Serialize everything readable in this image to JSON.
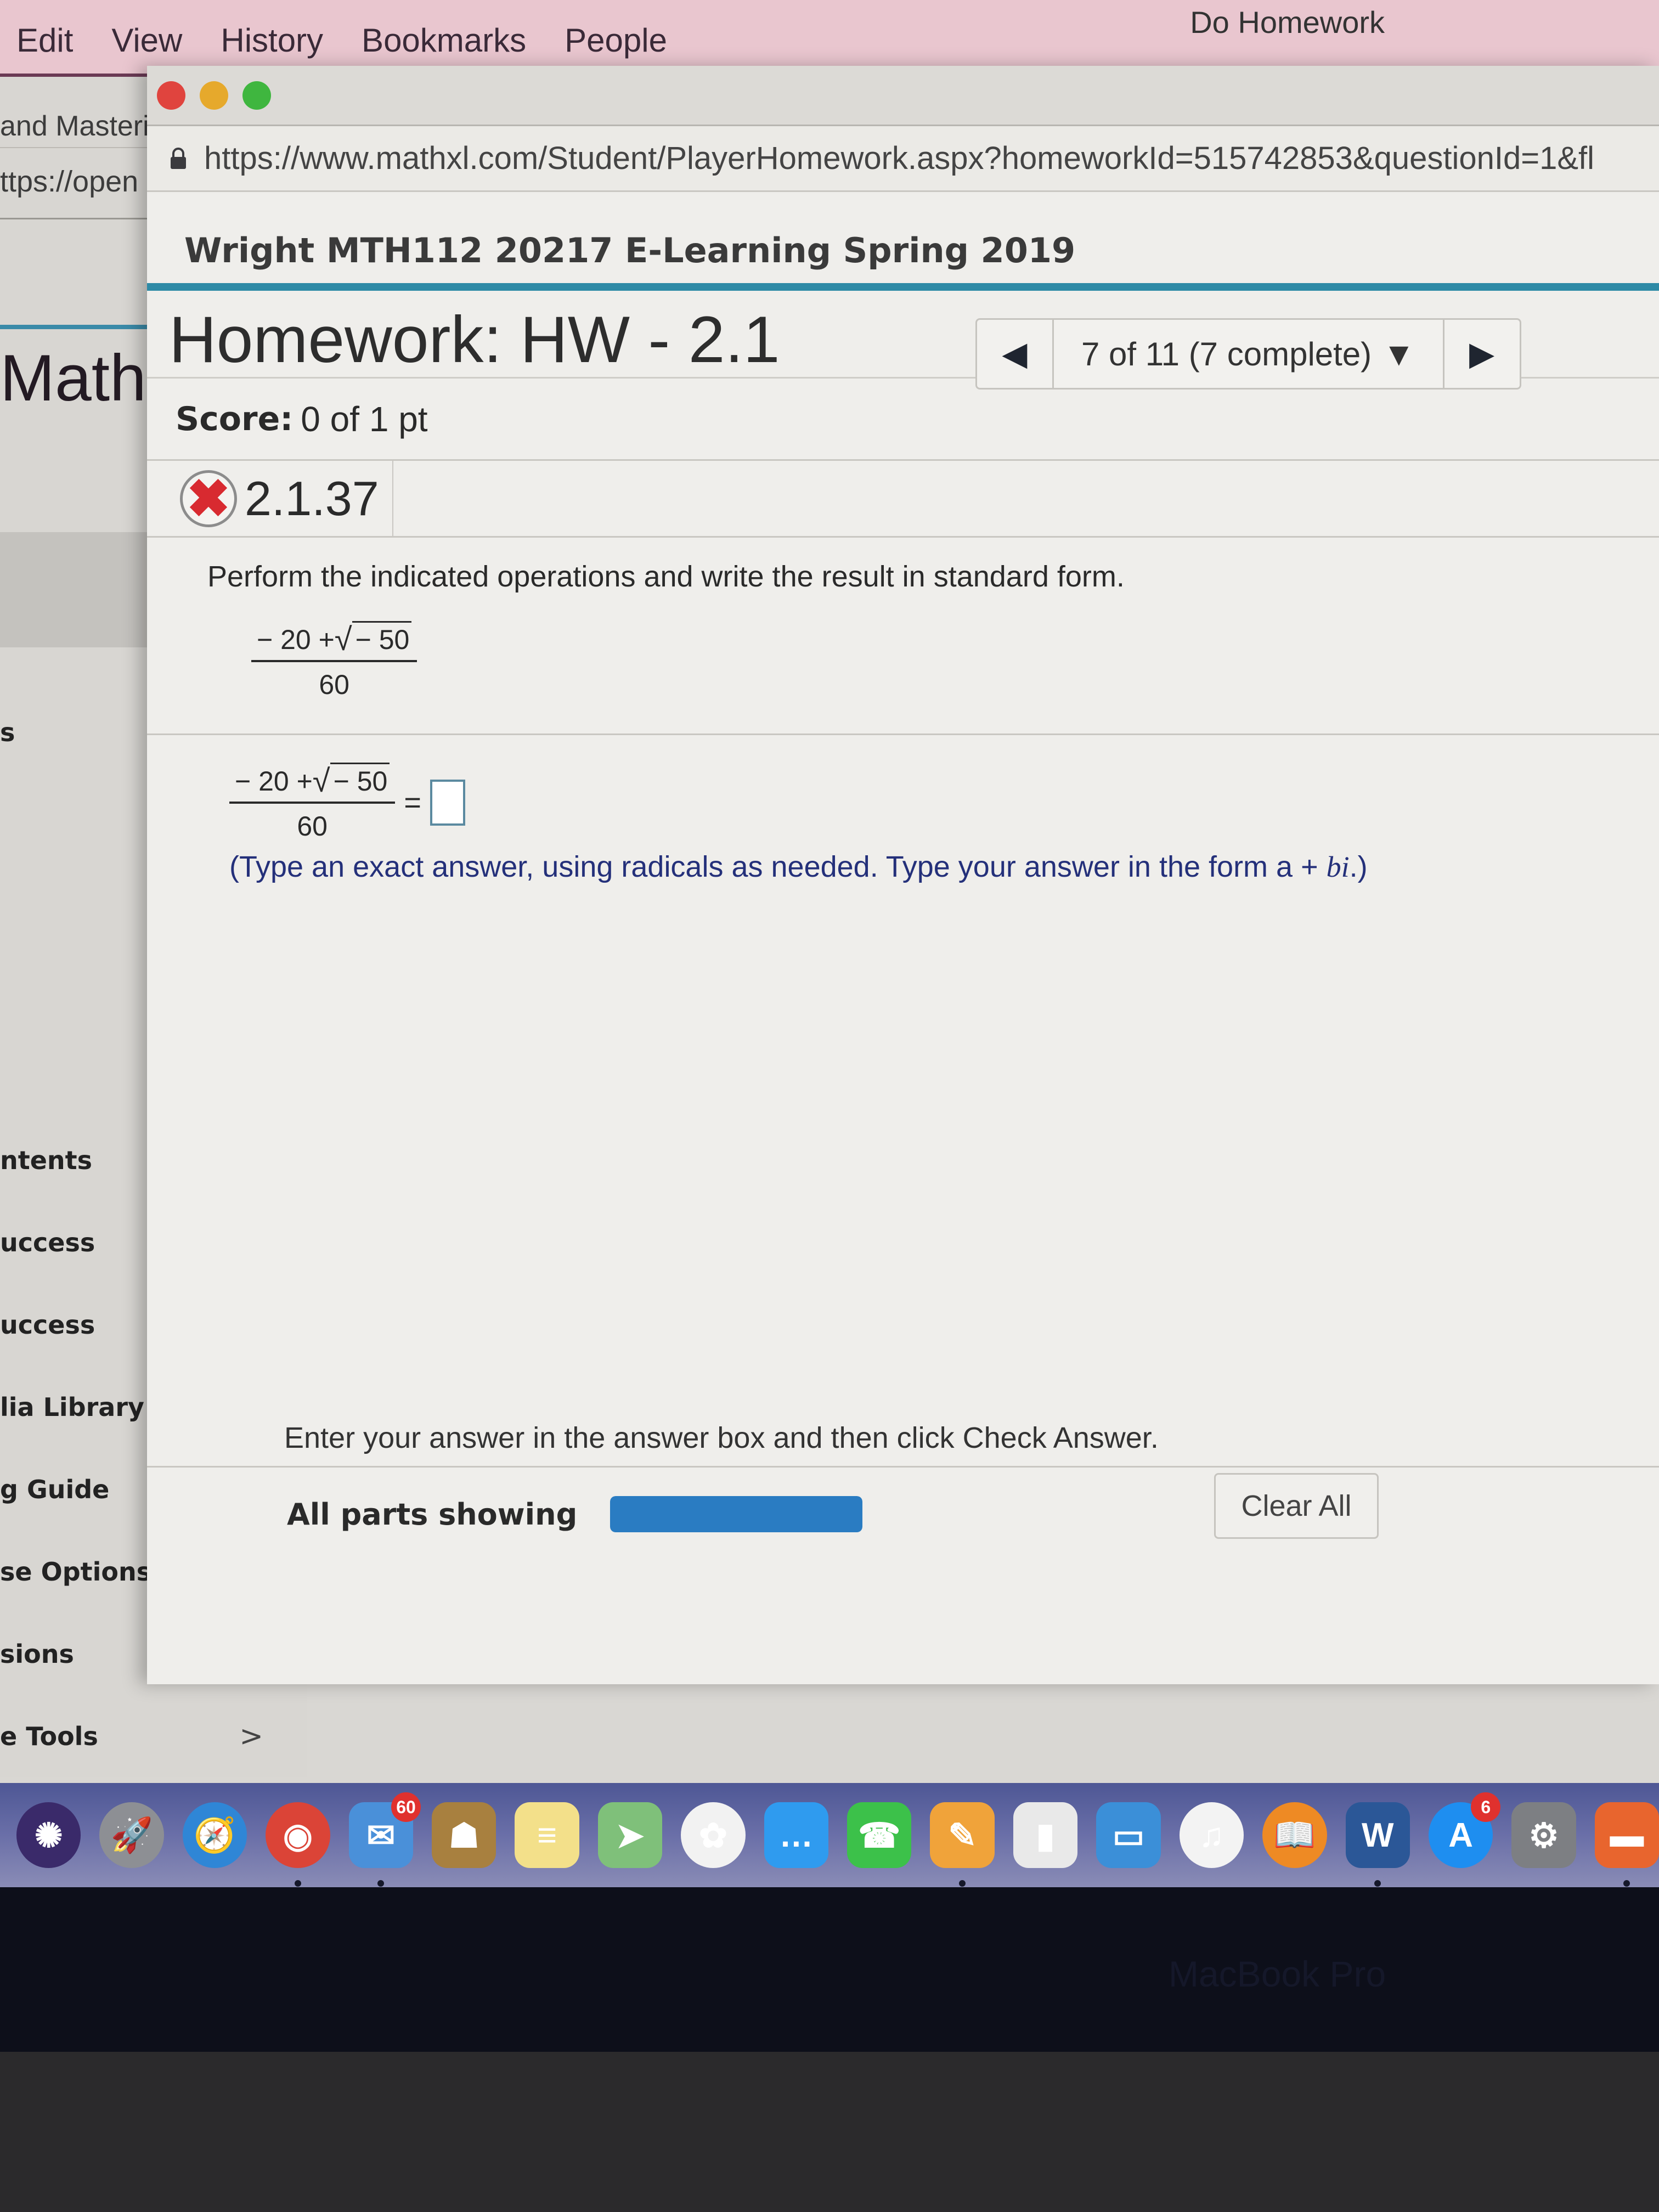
{
  "menubar": {
    "items": [
      "Edit",
      "View",
      "History",
      "Bookmarks",
      "People"
    ],
    "window_title": "Do Homework"
  },
  "background_window": {
    "tab_title": "and Masteri",
    "url_fragment": "ttps://open",
    "heading": "Math",
    "fragment_s": "s",
    "nav_items": [
      {
        "label": "ntents",
        "has_chevron": true
      },
      {
        "label": "uccess",
        "has_chevron": true
      },
      {
        "label": "uccess",
        "has_chevron": false
      },
      {
        "label": "lia Library",
        "has_chevron": false
      },
      {
        "label": "g Guide",
        "has_chevron": false
      },
      {
        "label": "se Options",
        "has_chevron": false
      },
      {
        "label": "sions",
        "has_chevron": false
      },
      {
        "label": "e Tools",
        "has_chevron": true
      }
    ],
    "chevron": ">"
  },
  "browser": {
    "traffic_lights": {
      "close": "#e0443e",
      "minimize": "#e6a92c",
      "zoom": "#3fb63f"
    },
    "url": "https://www.mathxl.com/Student/PlayerHomework.aspx?homeworkId=515742853&questionId=1&fl"
  },
  "course": {
    "title": "Wright MTH112 20217 E-Learning Spring 2019",
    "accent_color": "#2e8aa6"
  },
  "homework": {
    "title": "Homework: HW - 2.1",
    "nav": {
      "prev_icon": "◀",
      "status": "7 of 11 (7 complete)",
      "dropdown_icon": "▼",
      "next_icon": "▶",
      "current": 7,
      "total": 11,
      "complete": 7
    },
    "score_label": "Score:",
    "score_value": "0 of 1 pt"
  },
  "question": {
    "status_icon": "✖",
    "id": "2.1.37",
    "instruction": "Perform the indicated operations and write the result in standard form.",
    "expression": {
      "numerator_prefix": "− 20 + ",
      "radical_sign": "√",
      "radicand": "− 50",
      "denominator": "60"
    },
    "equals": "=",
    "answer_value": "",
    "hint_prefix": "(Type an exact answer, using radicals as needed. Type your answer in the form a + ",
    "hint_bi": "bi",
    "hint_suffix": ".)"
  },
  "footer": {
    "instruction": "Enter your answer in the answer box and then click Check Answer.",
    "parts_label": "All parts showing",
    "parts_progress_fraction": 1.0,
    "clear_all_label": "Clear All"
  },
  "dock": {
    "apps": [
      {
        "name": "Siri",
        "glyph": "✺",
        "color": "#3a2a6a",
        "badge": null,
        "running": false
      },
      {
        "name": "Launchpad",
        "glyph": "🚀",
        "color": "#8d8f94",
        "badge": null,
        "running": false
      },
      {
        "name": "Safari",
        "glyph": "🧭",
        "color": "#2f86d6",
        "badge": null,
        "running": false
      },
      {
        "name": "Chrome",
        "glyph": "◉",
        "color": "#db4437",
        "badge": null,
        "running": true
      },
      {
        "name": "Mail",
        "glyph": "✉",
        "color": "#4a90d9",
        "badge": "60",
        "running": true
      },
      {
        "name": "Contacts",
        "glyph": "☗",
        "color": "#a8803f",
        "badge": null,
        "running": false
      },
      {
        "name": "Notes",
        "glyph": "≡",
        "color": "#f3e08a",
        "badge": null,
        "running": false
      },
      {
        "name": "Maps",
        "glyph": "➤",
        "color": "#7fc07a",
        "badge": null,
        "running": false
      },
      {
        "name": "Photos",
        "glyph": "✿",
        "color": "#f2f2f2",
        "badge": null,
        "running": false
      },
      {
        "name": "Messages",
        "glyph": "…",
        "color": "#2f9bef",
        "badge": null,
        "running": false
      },
      {
        "name": "FaceTime",
        "glyph": "☎",
        "color": "#3cc14a",
        "badge": null,
        "running": false
      },
      {
        "name": "Pages",
        "glyph": "✎",
        "color": "#f0a33a",
        "badge": null,
        "running": true
      },
      {
        "name": "Numbers",
        "glyph": "▮",
        "color": "#e9e9e9",
        "badge": null,
        "running": false
      },
      {
        "name": "Keynote",
        "glyph": "▭",
        "color": "#3b8fd8",
        "badge": null,
        "running": false
      },
      {
        "name": "iTunes",
        "glyph": "♫",
        "color": "#f3f3f3",
        "badge": null,
        "running": false
      },
      {
        "name": "iBooks",
        "glyph": "📖",
        "color": "#ee8a24",
        "badge": null,
        "running": false
      },
      {
        "name": "Microsoft Word",
        "glyph": "W",
        "color": "#2b5797",
        "badge": null,
        "running": true
      },
      {
        "name": "App Store",
        "glyph": "A",
        "color": "#1e8ef0",
        "badge": "6",
        "running": false
      },
      {
        "name": "System Preferences",
        "glyph": "⚙",
        "color": "#7d7f83",
        "badge": null,
        "running": false
      },
      {
        "name": "Folder",
        "glyph": "▬",
        "color": "#e8652e",
        "badge": null,
        "running": true
      }
    ]
  },
  "bezel": {
    "label": "MacBook Pro"
  }
}
